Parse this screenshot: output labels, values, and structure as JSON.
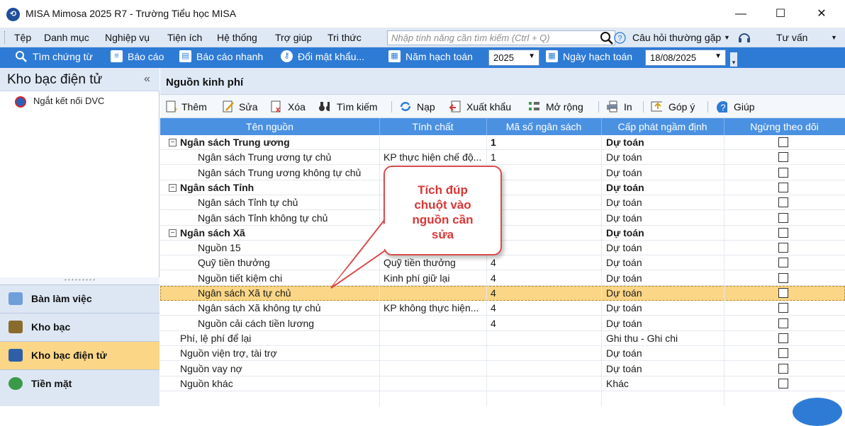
{
  "window": {
    "title": "MISA Mimosa 2025 R7 - Trường Tiểu học MISA",
    "minimize": "—",
    "maximize": "☐",
    "close": "✕"
  },
  "menu": {
    "items": [
      "Tệp",
      "Danh mục",
      "Nghiệp vụ",
      "Tiện ích",
      "Hệ thống",
      "Trợ giúp",
      "Tri thức"
    ],
    "search_placeholder": "Nhập tính năng cần tìm kiếm (Ctrl + Q)",
    "faq": "Câu hỏi thường gặp",
    "consult": "Tư vấn"
  },
  "toolbar": {
    "find_voucher": "Tìm chứng từ",
    "report": "Báo cáo",
    "quick_report": "Báo cáo nhanh",
    "change_password": "Đổi mật khẩu...",
    "fiscal_year_label": "Năm hạch toán",
    "fiscal_year_value": "2025",
    "posting_date_label": "Ngày hạch toán",
    "posting_date_value": "18/08/2025"
  },
  "left_panel": {
    "title": "Kho bạc điện tử",
    "collapse": "«",
    "disconnect": "Ngắt kết nối DVC",
    "nav": [
      "Bàn làm việc",
      "Kho bạc",
      "Kho bạc điện tử",
      "Tiền mặt"
    ],
    "active_nav": "Kho bạc điện tử"
  },
  "main": {
    "title": "Nguồn kinh phí",
    "actions": {
      "add": "Thêm",
      "edit": "Sửa",
      "delete": "Xóa",
      "search": "Tìm kiếm",
      "load": "Nạp",
      "export": "Xuất khẩu",
      "expand": "Mở rộng",
      "print": "In",
      "feedback": "Góp ý",
      "help": "Giúp"
    },
    "columns": [
      "Tên nguồn",
      "Tính chất",
      "Mã số ngân sách",
      "Cấp phát ngầm định",
      "Ngừng theo dõi"
    ],
    "rows": [
      {
        "name": "Ngân sách Trung ương",
        "nature": "",
        "code": "1",
        "alloc": "Dự toán",
        "group": true
      },
      {
        "name": "Ngân sách Trung ương tự chủ",
        "nature": "KP thực hiện chế độ...",
        "code": "1",
        "alloc": "Dự toán",
        "group": false
      },
      {
        "name": "Ngân sách Trung ương không tự chủ",
        "nature": "",
        "code": "",
        "alloc": "Dự toán",
        "group": false
      },
      {
        "name": "Ngân sách Tỉnh",
        "nature": "",
        "code": "",
        "alloc": "Dự toán",
        "group": true
      },
      {
        "name": "Ngân sách Tỉnh tự chủ",
        "nature": "",
        "code": "",
        "alloc": "Dự toán",
        "group": false
      },
      {
        "name": "Ngân sách Tỉnh không tự chủ",
        "nature": "",
        "code": "",
        "alloc": "Dự toán",
        "group": false
      },
      {
        "name": "Ngân sách Xã",
        "nature": "",
        "code": "",
        "alloc": "Dự toán",
        "group": true
      },
      {
        "name": "Nguồn 15",
        "nature": "",
        "code": "",
        "alloc": "Dự toán",
        "group": false
      },
      {
        "name": "Quỹ tiền thưởng",
        "nature": "Quỹ tiền thưởng",
        "code": "4",
        "alloc": "Dự toán",
        "group": false
      },
      {
        "name": "Nguồn tiết kiệm chi",
        "nature": "Kinh phí giữ lại",
        "code": "4",
        "alloc": "Dự toán",
        "group": false
      },
      {
        "name": "Ngân sách Xã tự chủ",
        "nature": "",
        "code": "4",
        "alloc": "Dự toán",
        "group": false
      },
      {
        "name": "Ngân sách Xã không tự chủ",
        "nature": "KP không thực hiện...",
        "code": "4",
        "alloc": "Dự toán",
        "group": false
      },
      {
        "name": "Nguồn cải cách tiền lương",
        "nature": "",
        "code": "4",
        "alloc": "Dự toán",
        "group": false
      },
      {
        "name": "Phí, lệ phí để lại",
        "nature": "",
        "code": "",
        "alloc": "Ghi thu - Ghi chi",
        "group": false
      },
      {
        "name": "Nguồn viện trợ, tài trợ",
        "nature": "",
        "code": "",
        "alloc": "Dự toán",
        "group": false
      },
      {
        "name": "Nguồn vay nợ",
        "nature": "",
        "code": "",
        "alloc": "Dự toán",
        "group": false
      },
      {
        "name": "Nguồn khác",
        "nature": "",
        "code": "",
        "alloc": "Khác",
        "group": false
      }
    ],
    "selected_row": "Ngân sách Xã tự chủ"
  },
  "callout": {
    "lines": [
      "Tích đúp",
      "chuột vào",
      "nguồn cần",
      "sửa"
    ]
  },
  "colors": {
    "accent": "#2e7bd6",
    "header": "#4b91e2",
    "selected": "#fbd687",
    "callout": "#d93636"
  }
}
